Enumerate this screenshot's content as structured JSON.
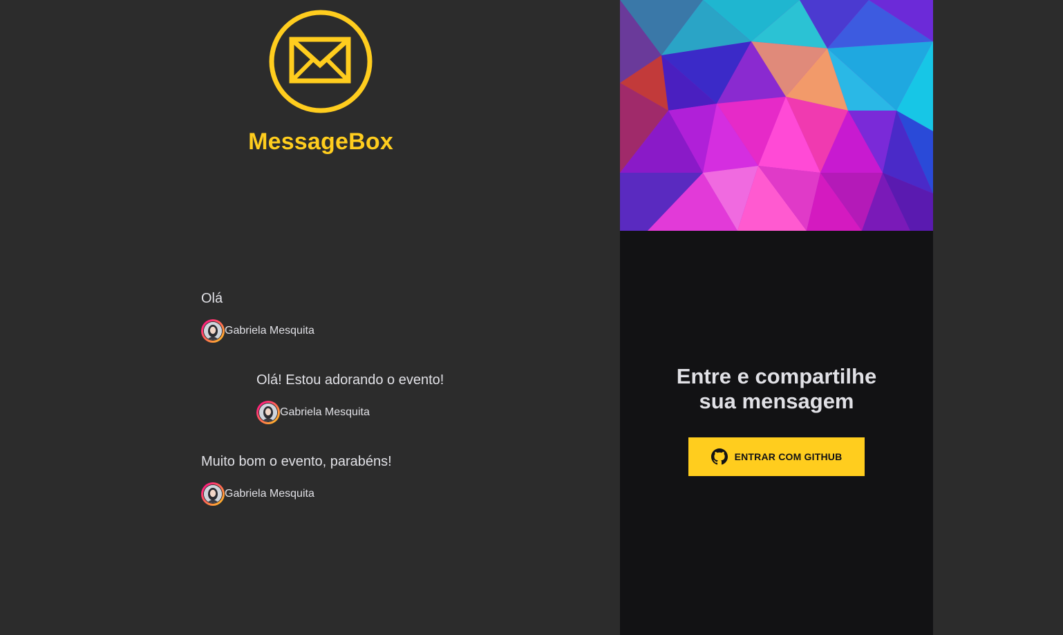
{
  "brand": {
    "name": "MessageBox",
    "logo_icon": "mail-icon",
    "color": "#ffcd1e"
  },
  "messages": [
    {
      "text": "Olá",
      "author": "Gabriela Mesquita",
      "avatar_icon": "user-avatar"
    },
    {
      "text": "Olá! Estou adorando o evento!",
      "author": "Gabriela Mesquita",
      "avatar_icon": "user-avatar"
    },
    {
      "text": "Muito bom o evento, parabéns!",
      "author": "Gabriela Mesquita",
      "avatar_icon": "user-avatar"
    }
  ],
  "signin": {
    "title_line1": "Entre e compartilhe",
    "title_line2": "sua mensagem",
    "button_label": "ENTRAR COM GITHUB",
    "button_icon": "github-icon",
    "button_color": "#ffcd1e"
  },
  "colors": {
    "background": "#2c2c2c",
    "panel": "#121214",
    "text": "#e1e1e6",
    "avatar_gradient_start": "#ff008e",
    "avatar_gradient_end": "#ffcd1e"
  }
}
